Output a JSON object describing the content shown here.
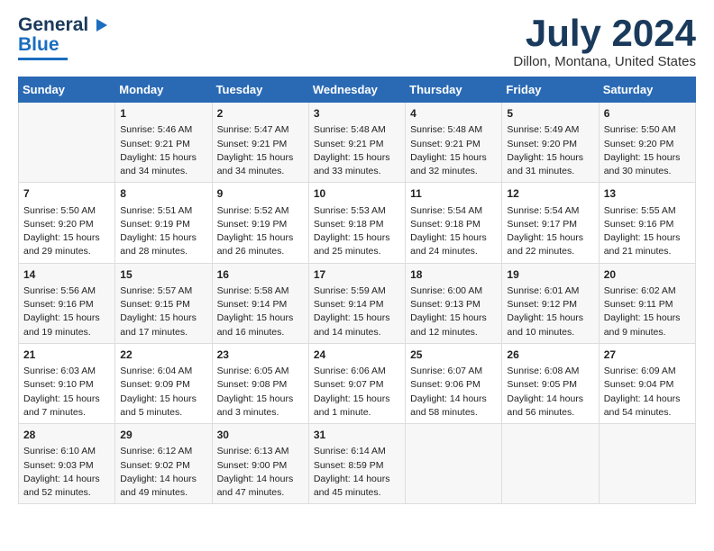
{
  "header": {
    "logo_line1": "General",
    "logo_line2": "Blue",
    "month": "July 2024",
    "location": "Dillon, Montana, United States"
  },
  "calendar": {
    "weekdays": [
      "Sunday",
      "Monday",
      "Tuesday",
      "Wednesday",
      "Thursday",
      "Friday",
      "Saturday"
    ],
    "weeks": [
      [
        {
          "day": "",
          "info": ""
        },
        {
          "day": "1",
          "info": "Sunrise: 5:46 AM\nSunset: 9:21 PM\nDaylight: 15 hours\nand 34 minutes."
        },
        {
          "day": "2",
          "info": "Sunrise: 5:47 AM\nSunset: 9:21 PM\nDaylight: 15 hours\nand 34 minutes."
        },
        {
          "day": "3",
          "info": "Sunrise: 5:48 AM\nSunset: 9:21 PM\nDaylight: 15 hours\nand 33 minutes."
        },
        {
          "day": "4",
          "info": "Sunrise: 5:48 AM\nSunset: 9:21 PM\nDaylight: 15 hours\nand 32 minutes."
        },
        {
          "day": "5",
          "info": "Sunrise: 5:49 AM\nSunset: 9:20 PM\nDaylight: 15 hours\nand 31 minutes."
        },
        {
          "day": "6",
          "info": "Sunrise: 5:50 AM\nSunset: 9:20 PM\nDaylight: 15 hours\nand 30 minutes."
        }
      ],
      [
        {
          "day": "7",
          "info": "Sunrise: 5:50 AM\nSunset: 9:20 PM\nDaylight: 15 hours\nand 29 minutes."
        },
        {
          "day": "8",
          "info": "Sunrise: 5:51 AM\nSunset: 9:19 PM\nDaylight: 15 hours\nand 28 minutes."
        },
        {
          "day": "9",
          "info": "Sunrise: 5:52 AM\nSunset: 9:19 PM\nDaylight: 15 hours\nand 26 minutes."
        },
        {
          "day": "10",
          "info": "Sunrise: 5:53 AM\nSunset: 9:18 PM\nDaylight: 15 hours\nand 25 minutes."
        },
        {
          "day": "11",
          "info": "Sunrise: 5:54 AM\nSunset: 9:18 PM\nDaylight: 15 hours\nand 24 minutes."
        },
        {
          "day": "12",
          "info": "Sunrise: 5:54 AM\nSunset: 9:17 PM\nDaylight: 15 hours\nand 22 minutes."
        },
        {
          "day": "13",
          "info": "Sunrise: 5:55 AM\nSunset: 9:16 PM\nDaylight: 15 hours\nand 21 minutes."
        }
      ],
      [
        {
          "day": "14",
          "info": "Sunrise: 5:56 AM\nSunset: 9:16 PM\nDaylight: 15 hours\nand 19 minutes."
        },
        {
          "day": "15",
          "info": "Sunrise: 5:57 AM\nSunset: 9:15 PM\nDaylight: 15 hours\nand 17 minutes."
        },
        {
          "day": "16",
          "info": "Sunrise: 5:58 AM\nSunset: 9:14 PM\nDaylight: 15 hours\nand 16 minutes."
        },
        {
          "day": "17",
          "info": "Sunrise: 5:59 AM\nSunset: 9:14 PM\nDaylight: 15 hours\nand 14 minutes."
        },
        {
          "day": "18",
          "info": "Sunrise: 6:00 AM\nSunset: 9:13 PM\nDaylight: 15 hours\nand 12 minutes."
        },
        {
          "day": "19",
          "info": "Sunrise: 6:01 AM\nSunset: 9:12 PM\nDaylight: 15 hours\nand 10 minutes."
        },
        {
          "day": "20",
          "info": "Sunrise: 6:02 AM\nSunset: 9:11 PM\nDaylight: 15 hours\nand 9 minutes."
        }
      ],
      [
        {
          "day": "21",
          "info": "Sunrise: 6:03 AM\nSunset: 9:10 PM\nDaylight: 15 hours\nand 7 minutes."
        },
        {
          "day": "22",
          "info": "Sunrise: 6:04 AM\nSunset: 9:09 PM\nDaylight: 15 hours\nand 5 minutes."
        },
        {
          "day": "23",
          "info": "Sunrise: 6:05 AM\nSunset: 9:08 PM\nDaylight: 15 hours\nand 3 minutes."
        },
        {
          "day": "24",
          "info": "Sunrise: 6:06 AM\nSunset: 9:07 PM\nDaylight: 15 hours\nand 1 minute."
        },
        {
          "day": "25",
          "info": "Sunrise: 6:07 AM\nSunset: 9:06 PM\nDaylight: 14 hours\nand 58 minutes."
        },
        {
          "day": "26",
          "info": "Sunrise: 6:08 AM\nSunset: 9:05 PM\nDaylight: 14 hours\nand 56 minutes."
        },
        {
          "day": "27",
          "info": "Sunrise: 6:09 AM\nSunset: 9:04 PM\nDaylight: 14 hours\nand 54 minutes."
        }
      ],
      [
        {
          "day": "28",
          "info": "Sunrise: 6:10 AM\nSunset: 9:03 PM\nDaylight: 14 hours\nand 52 minutes."
        },
        {
          "day": "29",
          "info": "Sunrise: 6:12 AM\nSunset: 9:02 PM\nDaylight: 14 hours\nand 49 minutes."
        },
        {
          "day": "30",
          "info": "Sunrise: 6:13 AM\nSunset: 9:00 PM\nDaylight: 14 hours\nand 47 minutes."
        },
        {
          "day": "31",
          "info": "Sunrise: 6:14 AM\nSunset: 8:59 PM\nDaylight: 14 hours\nand 45 minutes."
        },
        {
          "day": "",
          "info": ""
        },
        {
          "day": "",
          "info": ""
        },
        {
          "day": "",
          "info": ""
        }
      ]
    ]
  }
}
